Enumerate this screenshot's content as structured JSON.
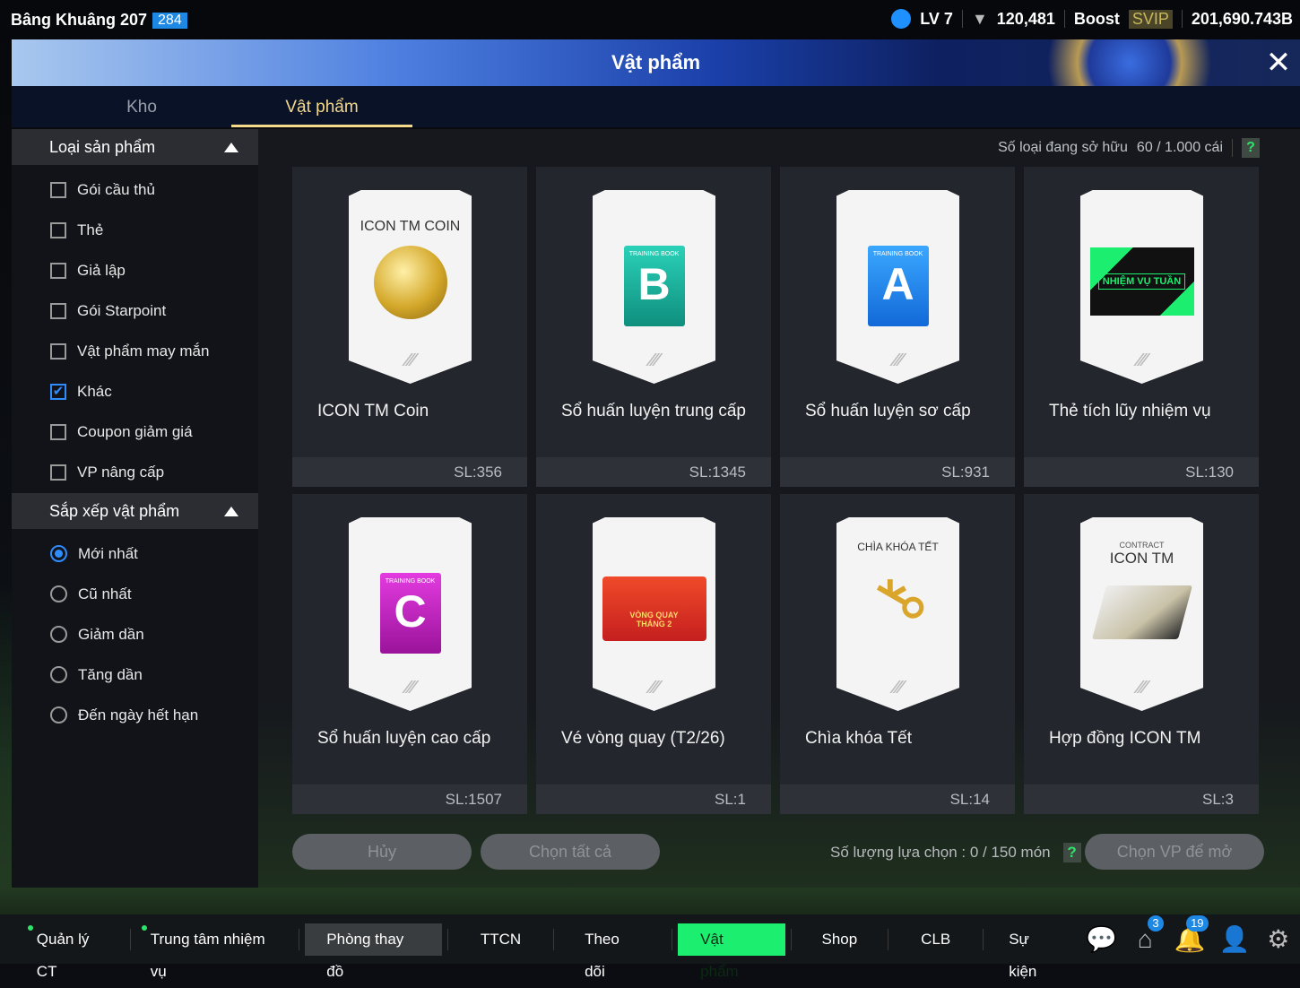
{
  "topbar": {
    "username": "Bâng Khuâng 207",
    "user_badge": "284",
    "level": "LV 7",
    "trophy": "120,481",
    "boost": "Boost",
    "svip": "SVIP",
    "currency": "201,690.743B"
  },
  "header": {
    "title": "Vật phẩm"
  },
  "tabs": [
    {
      "label": "Kho"
    },
    {
      "label": "Vật phẩm"
    }
  ],
  "sidebar": {
    "filter_title": "Loại sản phẩm",
    "filters": [
      {
        "label": "Gói cầu thủ",
        "checked": false
      },
      {
        "label": "Thẻ",
        "checked": false
      },
      {
        "label": "Giả lập",
        "checked": false
      },
      {
        "label": "Gói Starpoint",
        "checked": false
      },
      {
        "label": "Vật phẩm may mắn",
        "checked": false
      },
      {
        "label": "Khác",
        "checked": true
      },
      {
        "label": "Coupon giảm giá",
        "checked": false
      },
      {
        "label": "VP nâng cấp",
        "checked": false
      }
    ],
    "sort_title": "Sắp xếp vật phẩm",
    "sorts": [
      {
        "label": "Mới nhất",
        "selected": true
      },
      {
        "label": "Cũ nhất"
      },
      {
        "label": "Giảm dần"
      },
      {
        "label": "Tăng dần"
      },
      {
        "label": "Đến ngày hết hạn"
      }
    ]
  },
  "main": {
    "owned_label": "Số loại đang sở hữu",
    "owned_value": "60 / 1.000 cái",
    "help": "?",
    "items": [
      {
        "name": "ICON TM Coin",
        "qty": "SL:356",
        "caption": "ICON TM COIN"
      },
      {
        "name": "Sổ huấn luyện trung cấp",
        "qty": "SL:1345",
        "book_title": "TRAINING BOOK",
        "letter": "B"
      },
      {
        "name": "Sổ huấn luyện sơ cấp",
        "qty": "SL:931",
        "book_title": "TRAINING BOOK",
        "letter": "A"
      },
      {
        "name": "Thẻ tích lũy nhiệm vụ",
        "qty": "SL:130",
        "caption": "NHIỆM VỤ TUẦN"
      },
      {
        "name": "Sổ huấn luyện cao cấp",
        "qty": "SL:1507",
        "book_title": "TRAINING BOOK",
        "letter": "C"
      },
      {
        "name": "Vé vòng quay (T2/26)",
        "qty": "SL:1",
        "caption": "VÒNG QUAY THÁNG 2"
      },
      {
        "name": "Chìa khóa Tết",
        "qty": "SL:14",
        "caption": "CHÌA KHÓA TẾT"
      },
      {
        "name": "Hợp đồng ICON TM",
        "qty": "SL:3",
        "caption_small": "CONTRACT",
        "caption": "ICON TM"
      }
    ]
  },
  "footer": {
    "cancel": "Hủy",
    "select_all": "Chọn tất cả",
    "selection_label": "Số lượng lựa chọn : 0 / 150 món",
    "help": "?",
    "open": "Chọn VP để mở"
  },
  "nav": {
    "items": [
      "Quản lý CT",
      "Trung tâm nhiệm vụ",
      "Phòng thay đồ",
      "TTCN",
      "Theo dõi",
      "Vật phẩm",
      "Shop",
      "CLB",
      "Sự kiện"
    ],
    "mail_count": "3",
    "notif_count": "19"
  },
  "colors": {
    "accent": "#1cef6f",
    "gold": "#f4d98a",
    "check": "#2f8cff"
  }
}
